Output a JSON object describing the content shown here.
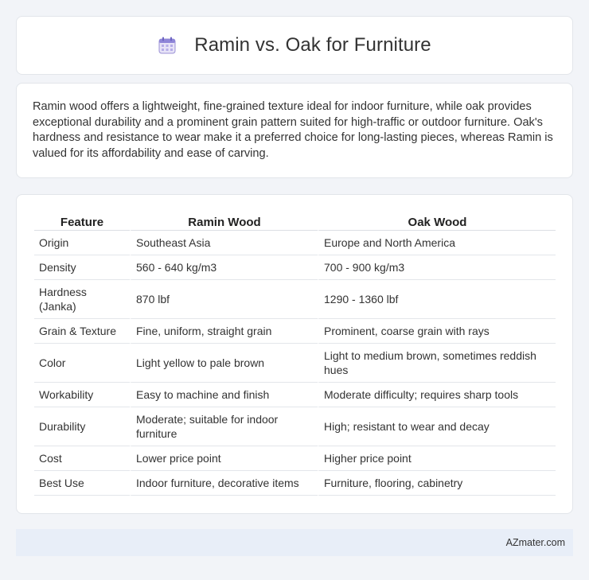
{
  "header": {
    "title": "Ramin vs. Oak for Furniture",
    "icon": "calendar-icon"
  },
  "intro": {
    "text": "Ramin wood offers a lightweight, fine-grained texture ideal for indoor furniture, while oak provides exceptional durability and a prominent grain pattern suited for high-traffic or outdoor furniture. Oak's hardness and resistance to wear make it a preferred choice for long-lasting pieces, whereas Ramin is valued for its affordability and ease of carving."
  },
  "table": {
    "headers": [
      "Feature",
      "Ramin Wood",
      "Oak Wood"
    ],
    "rows": [
      [
        "Origin",
        "Southeast Asia",
        "Europe and North America"
      ],
      [
        "Density",
        "560 - 640 kg/m3",
        "700 - 900 kg/m3"
      ],
      [
        "Hardness (Janka)",
        "870 lbf",
        "1290 - 1360 lbf"
      ],
      [
        "Grain & Texture",
        "Fine, uniform, straight grain",
        "Prominent, coarse grain with rays"
      ],
      [
        "Color",
        "Light yellow to pale brown",
        "Light to medium brown, sometimes reddish hues"
      ],
      [
        "Workability",
        "Easy to machine and finish",
        "Moderate difficulty; requires sharp tools"
      ],
      [
        "Durability",
        "Moderate; suitable for indoor furniture",
        "High; resistant to wear and decay"
      ],
      [
        "Cost",
        "Lower price point",
        "Higher price point"
      ],
      [
        "Best Use",
        "Indoor furniture, decorative items",
        "Furniture, flooring, cabinetry"
      ]
    ]
  },
  "footer": {
    "text": "AZmater.com"
  },
  "colors": {
    "background": "#f2f4f8",
    "footer_bg": "#e8eef8",
    "card_border": "#e2e5ea"
  }
}
